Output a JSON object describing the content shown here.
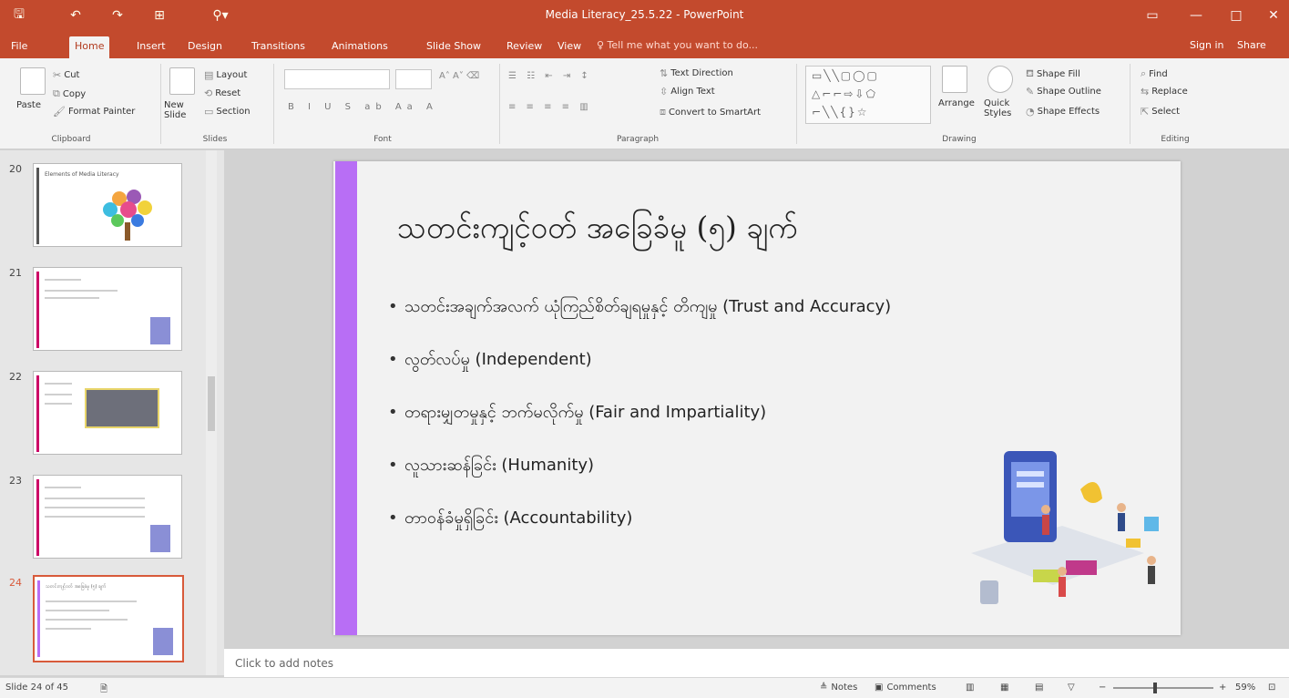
{
  "window": {
    "title": "Media Literacy_25.5.22 - PowerPoint",
    "buttons": [
      "▭",
      "—",
      "□",
      "✕"
    ]
  },
  "tabs": [
    "File",
    "Home",
    "Insert",
    "Design",
    "Transitions",
    "Animations",
    "Slide Show",
    "Review",
    "View"
  ],
  "tell_me": "♀ Tell me what you want to do...",
  "signin": "Sign in",
  "share": "Share",
  "ribbon": {
    "clipboard": {
      "paste": "Paste",
      "cut": "Cut",
      "copy": "Copy",
      "format_painter": "Format Painter",
      "label": "Clipboard"
    },
    "slides": {
      "new_slide": "New Slide",
      "layout": "Layout",
      "reset": "Reset",
      "section": "Section",
      "label": "Slides"
    },
    "font": {
      "label": "Font"
    },
    "paragraph": {
      "text_direction": "Text Direction",
      "align_text": "Align Text",
      "convert_smartart": "Convert to SmartArt",
      "label": "Paragraph"
    },
    "drawing": {
      "arrange": "Arrange",
      "quick_styles": "Quick Styles",
      "shape_fill": "Shape Fill",
      "shape_outline": "Shape Outline",
      "shape_effects": "Shape Effects",
      "label": "Drawing"
    },
    "editing": {
      "find": "Find",
      "replace": "Replace",
      "select": "Select",
      "label": "Editing"
    }
  },
  "thumbnails": [
    {
      "number": "20",
      "title": "Elements of Media Literacy"
    },
    {
      "number": "21",
      "title": ""
    },
    {
      "number": "22",
      "title": ""
    },
    {
      "number": "23",
      "title": ""
    },
    {
      "number": "24",
      "title": "သတင်းကျင့်ဝတ် အခြေခံမူ (၅) ချက်"
    }
  ],
  "slide": {
    "title": "သတင်းကျင့်ဝတ် အခြေခံမူ (၅) ချက်",
    "bullets": [
      "သတင်းအချက်အလက် ယုံကြည်စိတ်ချရမှုနှင့် တိကျမှု (Trust and Accuracy)",
      "လွတ်လပ်မှု (Independent)",
      "တရားမျှတမှုနှင့် ဘက်မလိုက်မှု (Fair and Impartiality)",
      "လူသားဆန်ခြင်း (Humanity)",
      "တာဝန်ခံမှုရှိခြင်း (Accountability)"
    ]
  },
  "notes_placeholder": "Click to add notes",
  "status": {
    "slide_counter": "Slide 24 of 45",
    "notes": "Notes",
    "comments": "Comments",
    "zoom": "59%"
  },
  "colors": {
    "accent": "#c34a2d",
    "slide_bar": "#b86ef5"
  }
}
